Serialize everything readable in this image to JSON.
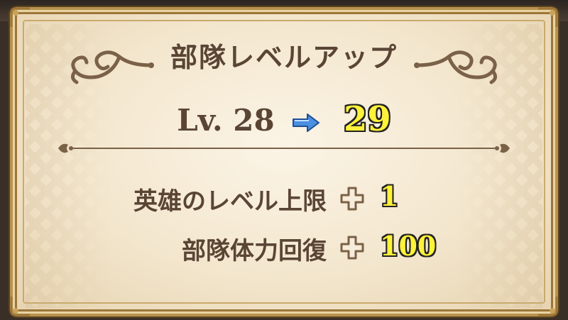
{
  "dialog": {
    "title": "部隊レベルアップ",
    "level": {
      "prefix": "Lv.",
      "old": "28",
      "new": "29"
    },
    "stats": [
      {
        "label": "英雄のレベル上限",
        "value": "1"
      },
      {
        "label": "部隊体力回復",
        "value": "100"
      }
    ]
  },
  "colors": {
    "text": "#5a4535",
    "highlight": "#fff23a",
    "arrow": "#4a8fe0",
    "frame": "#b8934f"
  },
  "icons": [
    "right-arrow-icon",
    "plus-icon",
    "flourish-ornament",
    "divider-ornament"
  ]
}
